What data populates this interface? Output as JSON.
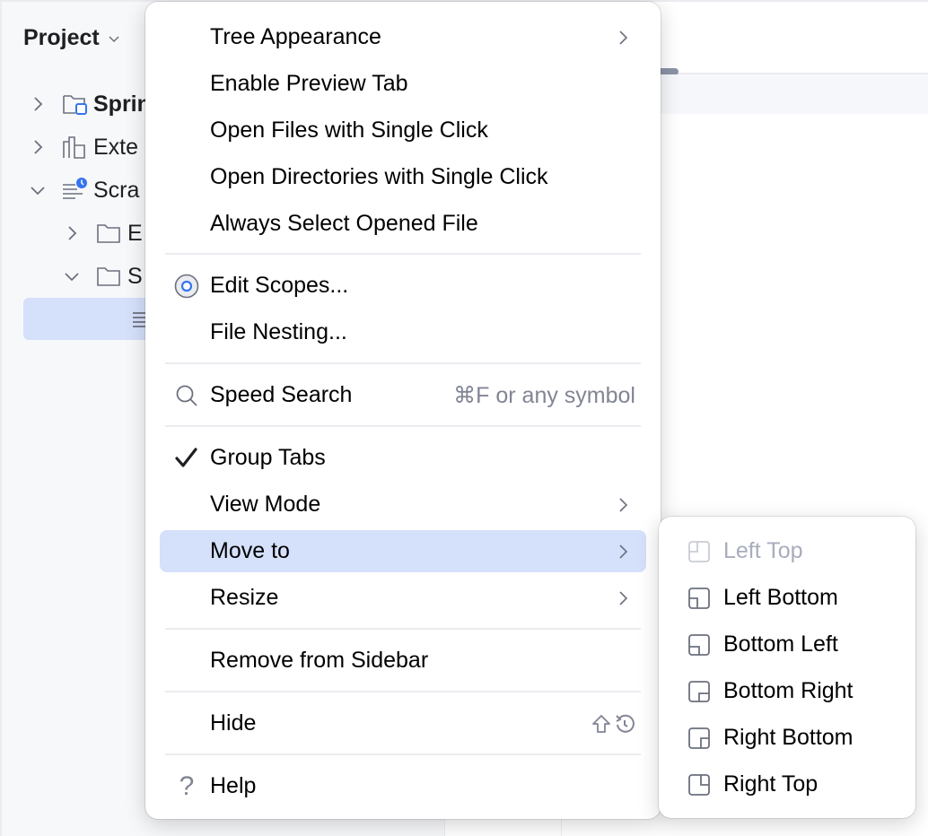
{
  "project_panel": {
    "title": "Project",
    "tree": [
      {
        "label": "Sprin",
        "icon": "module-folder-icon",
        "expanded": false,
        "bold": true
      },
      {
        "label": "Exte",
        "icon": "external-libraries-icon",
        "expanded": false
      },
      {
        "label": "Scra",
        "icon": "scratches-icon",
        "expanded": true
      },
      {
        "label": "E",
        "icon": "folder-icon",
        "expanded": false
      },
      {
        "label": "S",
        "icon": "folder-icon",
        "expanded": true
      },
      {
        "label": "",
        "icon": "text-file-icon",
        "selected": true
      }
    ]
  },
  "menu": {
    "items": [
      {
        "label": "Tree Appearance",
        "submenu": true
      },
      {
        "label": "Enable Preview Tab"
      },
      {
        "label": "Open Files with Single Click"
      },
      {
        "label": "Open Directories with Single Click"
      },
      {
        "label": "Always Select Opened File"
      },
      {
        "label": "Edit Scopes...",
        "icon": "scope-icon"
      },
      {
        "label": "File Nesting..."
      },
      {
        "label": "Speed Search",
        "icon": "search-icon",
        "shortcut": "⌘F or any symbol"
      },
      {
        "label": "Group Tabs",
        "icon": "checkmark-icon",
        "checked": true
      },
      {
        "label": "View Mode",
        "submenu": true
      },
      {
        "label": "Move to",
        "submenu": true,
        "selected": true
      },
      {
        "label": "Resize",
        "submenu": true
      },
      {
        "label": "Remove from Sidebar"
      },
      {
        "label": "Hide",
        "shortcut_icons": [
          "shift-icon",
          "escape-icon"
        ]
      },
      {
        "label": "Help",
        "icon": "help-icon"
      }
    ]
  },
  "submenu": {
    "items": [
      {
        "label": "Left Top",
        "icon": "left-top-icon",
        "disabled": true
      },
      {
        "label": "Left Bottom",
        "icon": "left-bottom-icon"
      },
      {
        "label": "Bottom Left",
        "icon": "bottom-left-icon"
      },
      {
        "label": "Bottom Right",
        "icon": "bottom-right-icon"
      },
      {
        "label": "Right Bottom",
        "icon": "right-bottom-icon"
      },
      {
        "label": "Right Top",
        "icon": "right-top-icon"
      }
    ]
  },
  "colors": {
    "selection": "#d5e0fb",
    "accent": "#3574f0",
    "icon_gray": "#6c707e",
    "disabled_text": "#a8adbd",
    "shortcut_text": "#818594"
  }
}
